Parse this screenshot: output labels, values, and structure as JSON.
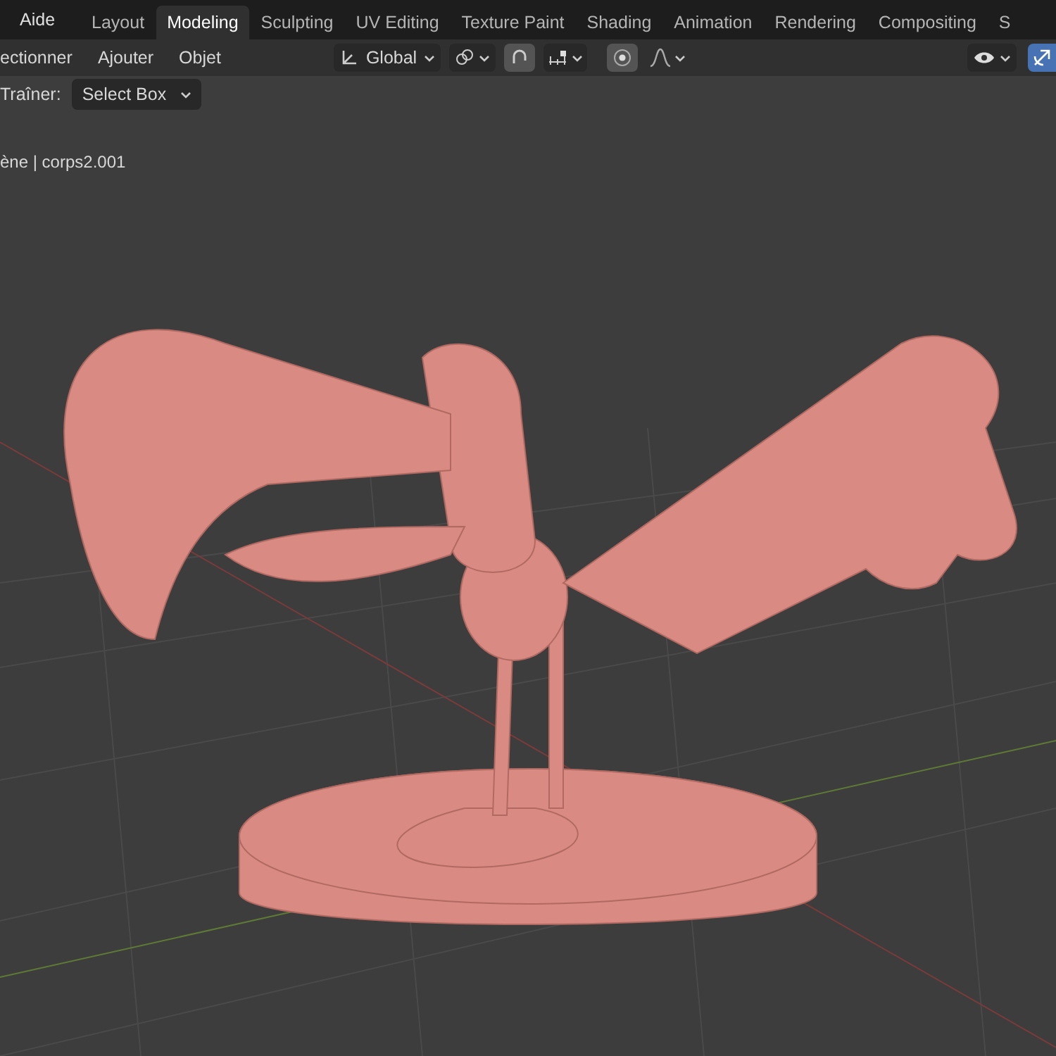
{
  "top_bar": {
    "menu": "Aide",
    "tabs": [
      {
        "label": "Layout",
        "selected": false
      },
      {
        "label": "Modeling",
        "selected": true
      },
      {
        "label": "Sculpting",
        "selected": false
      },
      {
        "label": "UV Editing",
        "selected": false
      },
      {
        "label": "Texture Paint",
        "selected": false
      },
      {
        "label": "Shading",
        "selected": false
      },
      {
        "label": "Animation",
        "selected": false
      },
      {
        "label": "Rendering",
        "selected": false
      },
      {
        "label": "Compositing",
        "selected": false
      },
      {
        "label": "S",
        "selected": false
      }
    ]
  },
  "header": {
    "menus": [
      "ectionner",
      "Ajouter",
      "Objet"
    ],
    "orientation": "Global",
    "snap_on": true,
    "proportional_on": true,
    "gizmo_on": true
  },
  "tool_settings": {
    "label": "Traîner:",
    "value": "Select Box"
  },
  "viewport": {
    "object_info": "ène | corps2.001"
  }
}
